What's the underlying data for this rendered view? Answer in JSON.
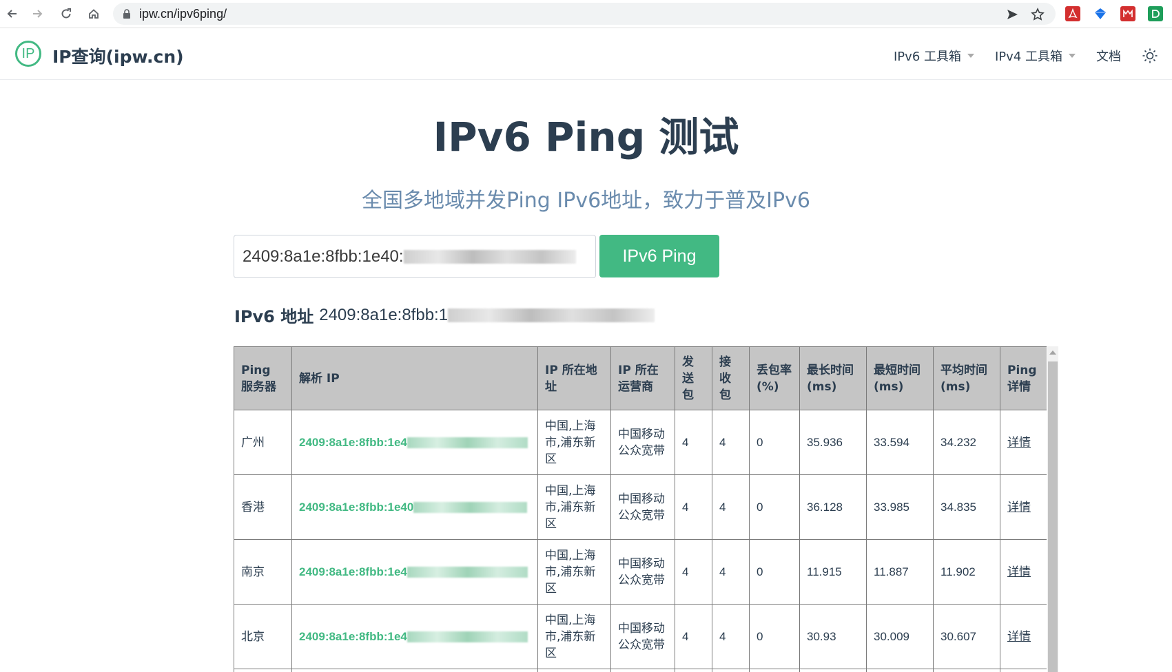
{
  "browser": {
    "url": "ipw.cn/ipv6ping/"
  },
  "header": {
    "logo_text": "IP",
    "site_title": "IP查询(ipw.cn)",
    "nav": [
      {
        "label": "IPv6 工具箱"
      },
      {
        "label": "IPv4 工具箱"
      },
      {
        "label": "文档"
      }
    ]
  },
  "hero": {
    "title": "IPv6 Ping 测试",
    "subtitle": "全国多地域并发Ping IPv6地址，致力于普及IPv6"
  },
  "form": {
    "input_value": "2409:8a1e:8fbb:1e40:",
    "button_label": "IPv6 Ping"
  },
  "address": {
    "label": "IPv6 地址",
    "value": "2409:8a1e:8fbb:1"
  },
  "table": {
    "headers": [
      "Ping 服务器",
      "解析 IP",
      "IP 所在地址",
      "IP 所在运营商",
      "发送包",
      "接收包",
      "丢包率(%)",
      "最长时间(ms)",
      "最短时间(ms)",
      "平均时间(ms)",
      "Ping 详情"
    ],
    "rows": [
      {
        "server": "广州",
        "ip": "2409:8a1e:8fbb:1e4",
        "location": "中国,上海市,浦东新区",
        "isp": "中国移动公众宽带",
        "sent": "4",
        "received": "4",
        "loss": "0",
        "max": "35.936",
        "min": "33.594",
        "avg": "34.232",
        "detail": "详情"
      },
      {
        "server": "香港",
        "ip": "2409:8a1e:8fbb:1e40",
        "location": "中国,上海市,浦东新区",
        "isp": "中国移动公众宽带",
        "sent": "4",
        "received": "4",
        "loss": "0",
        "max": "36.128",
        "min": "33.985",
        "avg": "34.835",
        "detail": "详情"
      },
      {
        "server": "南京",
        "ip": "2409:8a1e:8fbb:1e4",
        "location": "中国,上海市,浦东新区",
        "isp": "中国移动公众宽带",
        "sent": "4",
        "received": "4",
        "loss": "0",
        "max": "11.915",
        "min": "11.887",
        "avg": "11.902",
        "detail": "详情"
      },
      {
        "server": "北京",
        "ip": "2409:8a1e:8fbb:1e4",
        "location": "中国,上海市,浦东新区",
        "isp": "中国移动公众宽带",
        "sent": "4",
        "received": "4",
        "loss": "0",
        "max": "30.93",
        "min": "30.009",
        "avg": "30.607",
        "detail": "详情"
      }
    ]
  },
  "colors": {
    "accent": "#42b983",
    "heading": "#2c3e50",
    "subtitle": "#6a8bad",
    "table_header_bg": "#c5c5c5"
  },
  "icons": [
    "back-icon",
    "forward-icon",
    "reload-icon",
    "home-icon",
    "lock-icon",
    "send-icon",
    "star-icon",
    "pdf-extension-icon",
    "diamond-extension-icon",
    "mendeley-extension-icon",
    "d-extension-icon",
    "sun-icon"
  ]
}
